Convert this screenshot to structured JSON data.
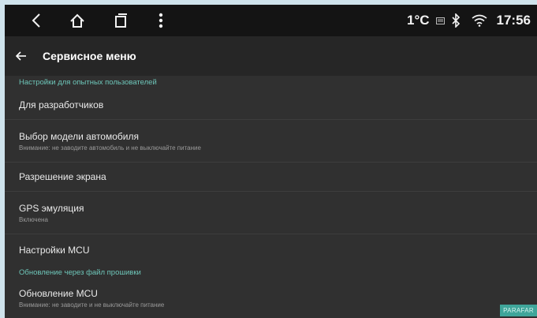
{
  "statusbar": {
    "temperature": "1°C",
    "time": "17:56",
    "icons": [
      "back-arrow-icon",
      "home-icon",
      "recents-icon",
      "menu-dots-icon",
      "cast-icon",
      "bluetooth-icon",
      "wifi-icon"
    ]
  },
  "toolbar": {
    "title": "Сервисное меню"
  },
  "sections": [
    {
      "header": "Настройки для опытных пользователей",
      "items": [
        {
          "title": "Для разработчиков"
        },
        {
          "title": "Выбор модели автомобиля",
          "subtitle": "Внимание: не заводите автомобиль и не выключайте питание"
        },
        {
          "title": "Разрешение экрана"
        },
        {
          "title": "GPS эмуляция",
          "subtitle": "Включена"
        },
        {
          "title": "Настройки MCU"
        }
      ]
    },
    {
      "header": "Обновление через файл прошивки",
      "items": [
        {
          "title": "Обновление MCU",
          "subtitle": "Внимание: не заводите и не выключайте питание"
        }
      ]
    }
  ],
  "watermark": "PARAFAR"
}
